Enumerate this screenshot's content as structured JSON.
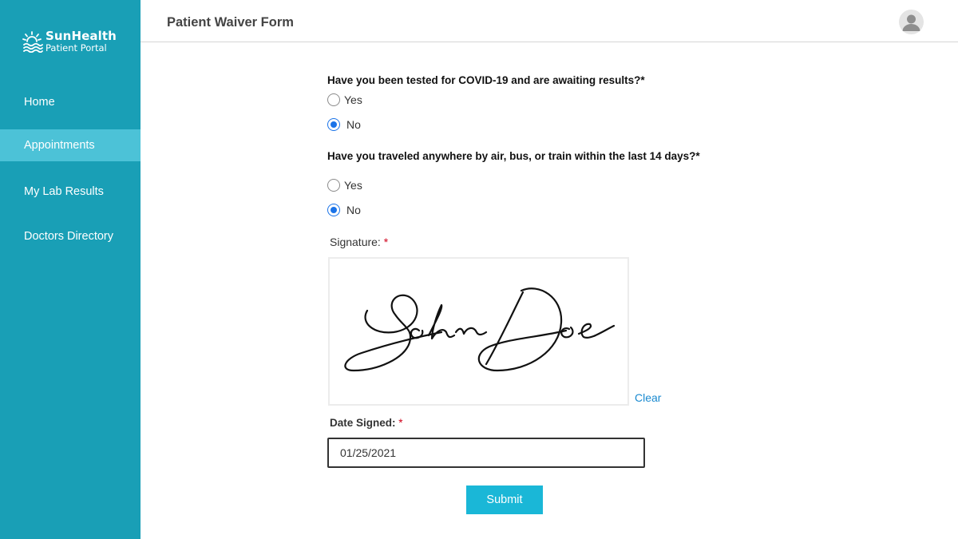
{
  "brand": {
    "name": "SunHealth",
    "subtitle": "Patient Portal",
    "icon": "sun-waves-logo-icon"
  },
  "sidebar": {
    "items": [
      {
        "label": "Home",
        "active": false
      },
      {
        "label": "Appointments",
        "active": true
      },
      {
        "label": "My Lab Results",
        "active": false
      },
      {
        "label": "Doctors Directory",
        "active": false
      }
    ]
  },
  "header": {
    "title": "Patient Waiver Form",
    "avatar_icon": "user-avatar-icon"
  },
  "form": {
    "questions": [
      {
        "text": "Have you been tested for COVID-19 and are awaiting results?",
        "required_mark": "*",
        "options": [
          {
            "label": "Yes",
            "checked": false
          },
          {
            "label": "No",
            "checked": true
          }
        ]
      },
      {
        "text": "Have you traveled anywhere by air, bus, or train within the last 14 days?",
        "required_mark": "*",
        "options": [
          {
            "label": "Yes",
            "checked": false
          },
          {
            "label": "No",
            "checked": true
          }
        ]
      }
    ],
    "signature": {
      "label": "Signature:",
      "required_mark": "*",
      "value": "John Doe",
      "clear_label": "Clear"
    },
    "date_signed": {
      "label": "Date Signed:",
      "required_mark": "*",
      "value": "01/25/2021"
    },
    "submit_label": "Submit"
  },
  "colors": {
    "sidebar_bg": "#199fb6",
    "sidebar_active": "#4cc2d7",
    "submit_bg": "#1ab7d7",
    "radio_checked": "#1a73e8",
    "link": "#1a8ad0",
    "required": "#d0021b"
  }
}
